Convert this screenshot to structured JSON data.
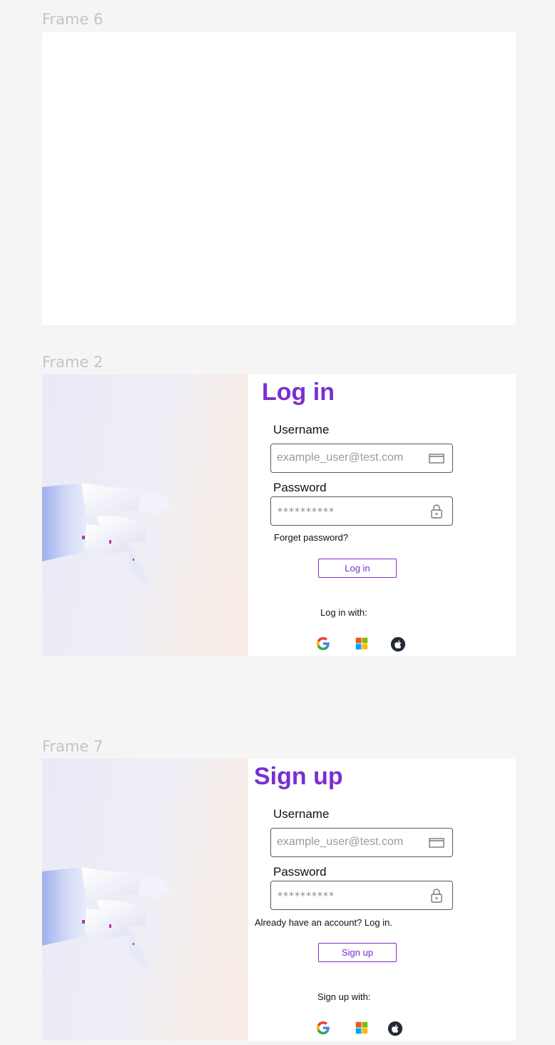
{
  "frames": {
    "frame6": {
      "label": "Frame 6"
    },
    "frame2": {
      "label": "Frame 2",
      "title": "Log in",
      "username_label": "Username",
      "username_value": "example_user@test.com",
      "password_label": "Password",
      "password_value": "**********",
      "forget_link": "Forget password?",
      "submit_label": "Log in",
      "social_label": "Log in with:",
      "social": [
        "google-icon",
        "microsoft-icon",
        "apple-icon"
      ]
    },
    "frame7": {
      "label": "Frame 7",
      "title": "Sign up",
      "username_label": "Username",
      "username_value": "example_user@test.com",
      "password_label": "Password",
      "password_value": "**********",
      "account_link": "Already have an account? Log in.",
      "submit_label": "Sign up",
      "social_label": "Sign up with:",
      "social": [
        "google-icon",
        "microsoft-icon",
        "apple-icon"
      ]
    }
  },
  "colors": {
    "accent": "#7b2ed0",
    "canvas": "#f5f5f5",
    "frame_bg": "#ffffff"
  }
}
